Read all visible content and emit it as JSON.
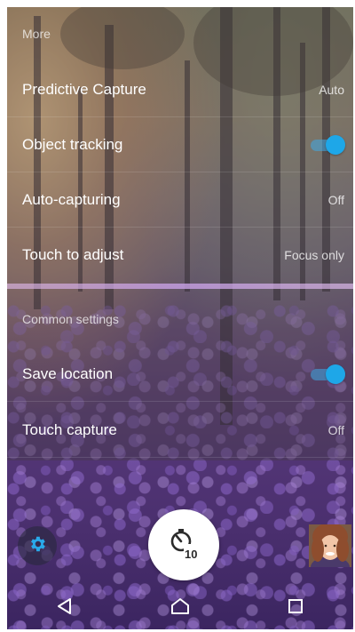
{
  "sections": {
    "more_header": "More",
    "common_header": "Common settings"
  },
  "settings": {
    "predictive_capture": {
      "label": "Predictive Capture",
      "value": "Auto"
    },
    "object_tracking": {
      "label": "Object tracking",
      "enabled": true
    },
    "auto_capturing": {
      "label": "Auto-capturing",
      "value": "Off"
    },
    "touch_to_adjust": {
      "label": "Touch to adjust",
      "value": "Focus only"
    },
    "save_location": {
      "label": "Save location",
      "enabled": true
    },
    "touch_capture": {
      "label": "Touch capture",
      "value": "Off"
    }
  },
  "camera": {
    "settings_icon": "gear-icon",
    "shutter_icon": "self-timer-10s-icon",
    "shutter_timer_text": "10",
    "thumbnail": "last-photo-thumbnail"
  },
  "navbar": {
    "back_icon": "back-triangle-icon",
    "home_icon": "home-icon",
    "recents_icon": "recents-square-icon"
  },
  "colors": {
    "accent": "#1ea7e8",
    "text": "#ffffff"
  }
}
